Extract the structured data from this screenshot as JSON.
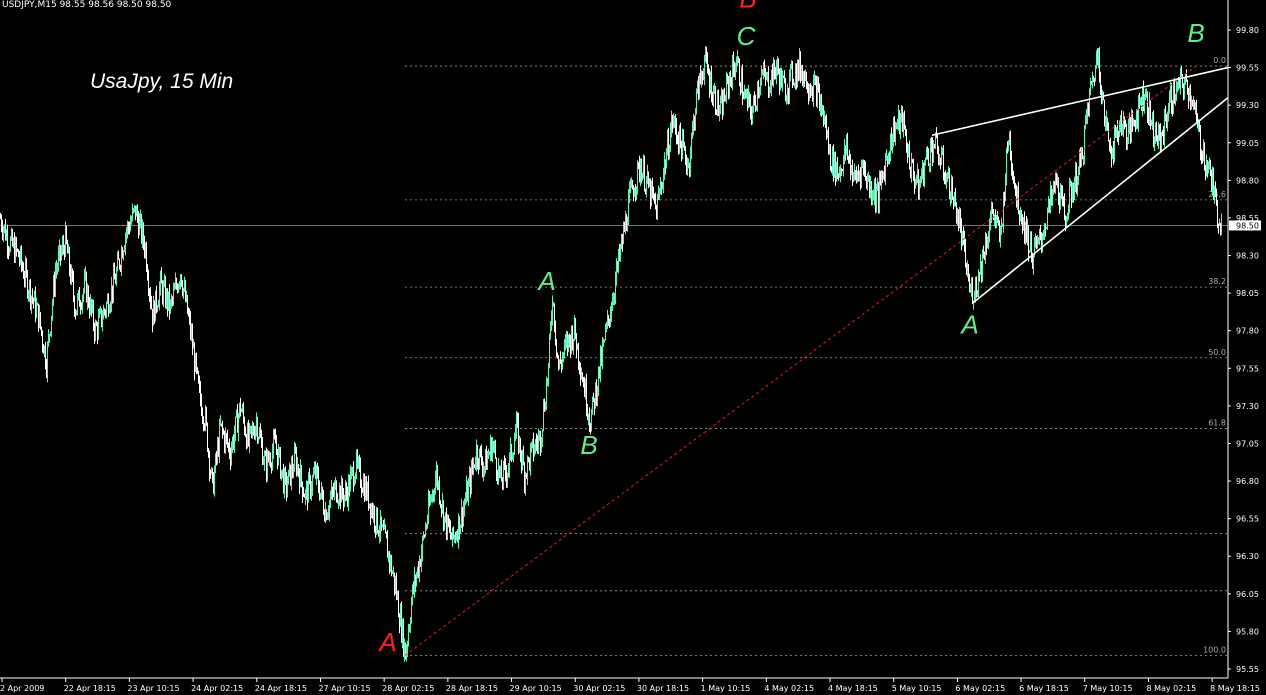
{
  "header": {
    "symbol": "USDJPY,M15",
    "open": "98.55",
    "high": "98.56",
    "low": "98.50",
    "close": "98.50"
  },
  "title": "UsaJpy, 15 Min",
  "colors": {
    "background": "#000000",
    "up_candle": "#5cf5b0",
    "down_candle": "#ffffff",
    "fib_line": "#9a9a9a",
    "trendline": "#e02020",
    "channel": "#ffffff",
    "label_green": "#5cf08a",
    "label_red": "#ff2020",
    "axis_text": "#ffffff"
  },
  "chart_data": {
    "type": "line",
    "description_series": "USDJPY 15-minute close price (approximate key points)",
    "series": [
      {
        "name": "",
        "x": [
          "2 Apr 2009",
          "22 Apr 18:15",
          "23 Apr 10:15",
          "24 Apr 02:15",
          "24 Apr 18:15",
          "27 Apr 10:15",
          "28 Apr 02:15",
          "28 Apr 18:15",
          "29 Apr 10:15",
          "30 Apr 02:15",
          "30 Apr 18:15",
          "1 May 10:15",
          "4 May 02:15",
          "4 May 18:15",
          "5 May 10:15",
          "6 May 02:15",
          "6 May 18:15",
          "7 May 10:15",
          "8 May 02:15",
          "8 May 18:15"
        ],
        "points": [
          [
            0,
            98.55
          ],
          [
            8,
            98.4
          ],
          [
            18,
            98.3
          ],
          [
            28,
            98.1
          ],
          [
            38,
            97.9
          ],
          [
            46,
            97.6
          ],
          [
            55,
            98.2
          ],
          [
            65,
            98.4
          ],
          [
            75,
            97.95
          ],
          [
            85,
            98.1
          ],
          [
            95,
            97.8
          ],
          [
            105,
            97.95
          ],
          [
            115,
            98.15
          ],
          [
            125,
            98.45
          ],
          [
            135,
            98.6
          ],
          [
            145,
            98.35
          ],
          [
            152,
            97.9
          ],
          [
            160,
            98.1
          ],
          [
            170,
            97.95
          ],
          [
            180,
            98.2
          ],
          [
            190,
            97.8
          ],
          [
            198,
            97.4
          ],
          [
            205,
            97.2
          ],
          [
            212,
            96.75
          ],
          [
            220,
            97.15
          ],
          [
            230,
            97.0
          ],
          [
            240,
            97.3
          ],
          [
            248,
            97.05
          ],
          [
            256,
            97.2
          ],
          [
            265,
            96.9
          ],
          [
            275,
            97.05
          ],
          [
            285,
            96.75
          ],
          [
            295,
            96.95
          ],
          [
            305,
            96.7
          ],
          [
            315,
            96.85
          ],
          [
            325,
            96.6
          ],
          [
            335,
            96.75
          ],
          [
            345,
            96.7
          ],
          [
            355,
            96.9
          ],
          [
            365,
            96.75
          ],
          [
            375,
            96.55
          ],
          [
            385,
            96.4
          ],
          [
            395,
            96.1
          ],
          [
            405,
            95.65
          ],
          [
            412,
            96.05
          ],
          [
            420,
            96.3
          ],
          [
            428,
            96.6
          ],
          [
            436,
            96.85
          ],
          [
            444,
            96.55
          ],
          [
            452,
            96.4
          ],
          [
            460,
            96.55
          ],
          [
            468,
            96.75
          ],
          [
            476,
            97.0
          ],
          [
            484,
            96.9
          ],
          [
            492,
            97.05
          ],
          [
            500,
            96.8
          ],
          [
            508,
            96.9
          ],
          [
            516,
            97.15
          ],
          [
            524,
            96.85
          ],
          [
            532,
            97.0
          ],
          [
            540,
            97.1
          ],
          [
            548,
            97.55
          ],
          [
            552,
            98.05
          ],
          [
            558,
            97.55
          ],
          [
            566,
            97.7
          ],
          [
            574,
            97.8
          ],
          [
            582,
            97.5
          ],
          [
            590,
            97.2
          ],
          [
            598,
            97.5
          ],
          [
            606,
            97.8
          ],
          [
            614,
            98.1
          ],
          [
            622,
            98.4
          ],
          [
            630,
            98.7
          ],
          [
            640,
            98.9
          ],
          [
            648,
            98.75
          ],
          [
            656,
            98.6
          ],
          [
            664,
            98.9
          ],
          [
            672,
            99.2
          ],
          [
            680,
            99.05
          ],
          [
            688,
            98.9
          ],
          [
            696,
            99.35
          ],
          [
            704,
            99.6
          ],
          [
            712,
            99.4
          ],
          [
            720,
            99.25
          ],
          [
            728,
            99.45
          ],
          [
            736,
            99.6
          ],
          [
            744,
            99.35
          ],
          [
            752,
            99.25
          ],
          [
            760,
            99.5
          ],
          [
            768,
            99.45
          ],
          [
            776,
            99.55
          ],
          [
            784,
            99.4
          ],
          [
            792,
            99.5
          ],
          [
            800,
            99.55
          ],
          [
            808,
            99.45
          ],
          [
            816,
            99.4
          ],
          [
            824,
            99.2
          ],
          [
            830,
            98.95
          ],
          [
            838,
            98.85
          ],
          [
            846,
            99.0
          ],
          [
            854,
            98.8
          ],
          [
            862,
            98.9
          ],
          [
            870,
            98.75
          ],
          [
            878,
            98.7
          ],
          [
            886,
            98.95
          ],
          [
            894,
            99.15
          ],
          [
            902,
            99.2
          ],
          [
            910,
            98.9
          ],
          [
            918,
            98.75
          ],
          [
            926,
            98.95
          ],
          [
            934,
            99.05
          ],
          [
            942,
            98.9
          ],
          [
            950,
            98.75
          ],
          [
            958,
            98.55
          ],
          [
            964,
            98.3
          ],
          [
            970,
            98.05
          ],
          [
            976,
            98.1
          ],
          [
            984,
            98.35
          ],
          [
            992,
            98.6
          ],
          [
            1000,
            98.4
          ],
          [
            1008,
            99.1
          ],
          [
            1016,
            98.7
          ],
          [
            1024,
            98.5
          ],
          [
            1032,
            98.3
          ],
          [
            1040,
            98.4
          ],
          [
            1048,
            98.6
          ],
          [
            1056,
            98.8
          ],
          [
            1064,
            98.55
          ],
          [
            1072,
            98.75
          ],
          [
            1080,
            98.9
          ],
          [
            1090,
            99.4
          ],
          [
            1098,
            99.65
          ],
          [
            1104,
            99.2
          ],
          [
            1112,
            99.0
          ],
          [
            1120,
            99.2
          ],
          [
            1128,
            99.1
          ],
          [
            1136,
            99.25
          ],
          [
            1144,
            99.4
          ],
          [
            1152,
            99.15
          ],
          [
            1160,
            99.05
          ],
          [
            1168,
            99.3
          ],
          [
            1176,
            99.4
          ],
          [
            1184,
            99.45
          ],
          [
            1192,
            99.35
          ],
          [
            1198,
            99.1
          ],
          [
            1204,
            98.95
          ],
          [
            1210,
            98.85
          ],
          [
            1216,
            98.6
          ],
          [
            1222,
            98.5
          ]
        ]
      }
    ],
    "y_axis_labels": [
      "99.80",
      "99.55",
      "99.30",
      "99.05",
      "98.80",
      "98.55",
      "98.30",
      "98.05",
      "97.80",
      "97.55",
      "97.30",
      "97.05",
      "96.80",
      "96.55",
      "96.30",
      "96.05",
      "95.80",
      "95.55"
    ],
    "x_axis_labels": [
      "2 Apr 2009",
      "22 Apr 18:15",
      "23 Apr 10:15",
      "24 Apr 02:15",
      "24 Apr 18:15",
      "27 Apr 10:15",
      "28 Apr 02:15",
      "28 Apr 18:15",
      "29 Apr 10:15",
      "30 Apr 02:15",
      "30 Apr 18:15",
      "1 May 10:15",
      "4 May 02:15",
      "4 May 18:15",
      "5 May 10:15",
      "6 May 02:15",
      "6 May 18:15",
      "7 May 10:15",
      "8 May 02:15",
      "8 May 18:15"
    ],
    "ylim": [
      95.55,
      99.8
    ],
    "current_price": "98.50",
    "fibonacci": [
      {
        "label": "0.0",
        "price": 99.56
      },
      {
        "label": "23.6",
        "price": 98.67
      },
      {
        "label": "38.2",
        "price": 98.09
      },
      {
        "label": "50.0",
        "price": 97.62
      },
      {
        "label": "61.8",
        "price": 97.15
      },
      {
        "label": "",
        "price": 96.45
      },
      {
        "label": "",
        "price": 96.07
      },
      {
        "label": "100.0",
        "price": 95.64
      }
    ],
    "fib_start_index": 405,
    "trendline": {
      "from": [
        405,
        95.64
      ],
      "to": [
        1196,
        99.56
      ]
    },
    "wedge": {
      "upper": {
        "from": [
          932,
          99.1
        ],
        "to": [
          1228,
          99.55
        ]
      },
      "lower": {
        "from": [
          972,
          97.98
        ],
        "to": [
          1228,
          99.35
        ]
      }
    },
    "annotations": [
      {
        "text": "A",
        "color": "red",
        "at": [
          388,
          95.67
        ]
      },
      {
        "text": "B",
        "color": "red",
        "at": [
          748,
          99.95
        ]
      },
      {
        "text": "C",
        "color": "green",
        "at": [
          746,
          99.7
        ]
      },
      {
        "text": "A",
        "color": "green",
        "at": [
          547,
          98.07
        ]
      },
      {
        "text": "B",
        "color": "green",
        "at": [
          589,
          96.98
        ]
      },
      {
        "text": "A",
        "color": "green",
        "at": [
          970,
          97.78
        ]
      },
      {
        "text": "B",
        "color": "green",
        "at": [
          1196,
          99.72
        ]
      }
    ]
  }
}
